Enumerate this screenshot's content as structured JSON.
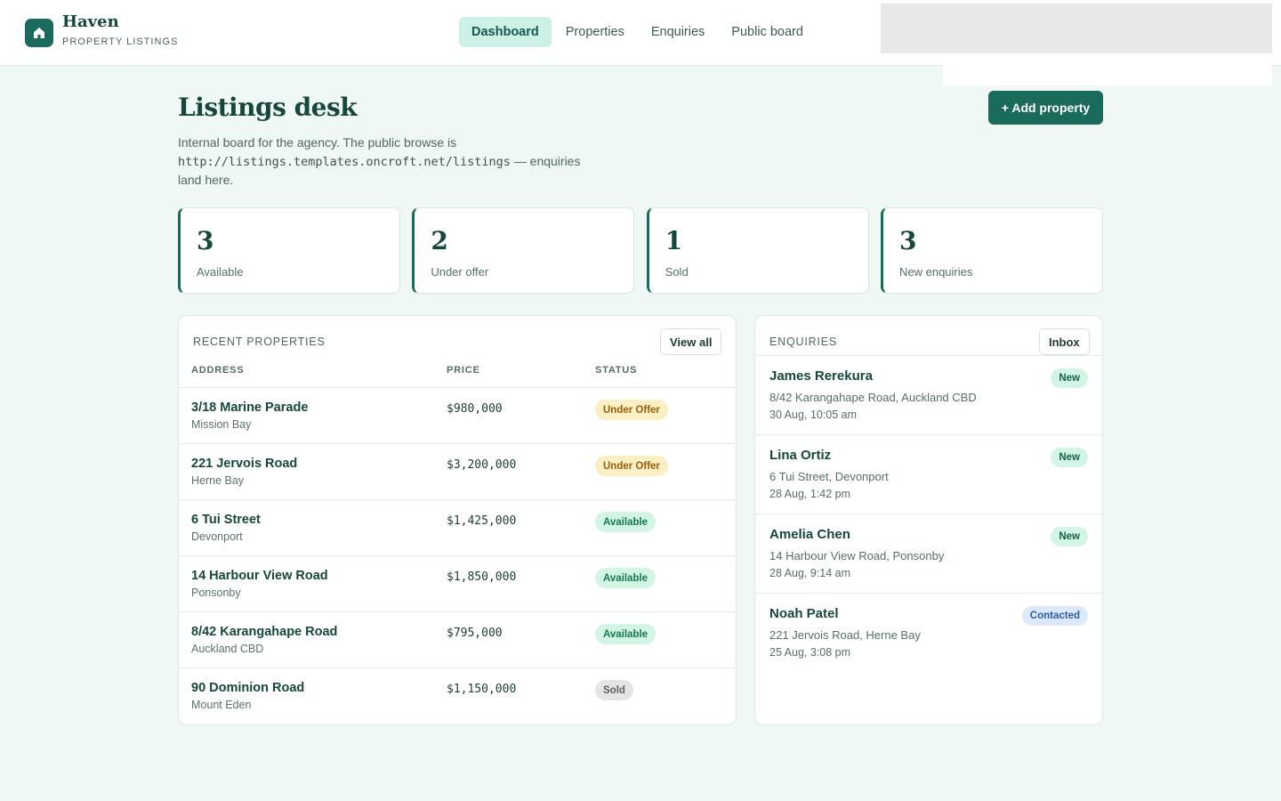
{
  "header": {
    "brand_name": "Haven",
    "brand_sub": "PROPERTY LISTINGS",
    "nav": [
      {
        "label": "Dashboard",
        "active": true
      },
      {
        "label": "Properties",
        "active": false
      },
      {
        "label": "Enquiries",
        "active": false
      },
      {
        "label": "Public board",
        "active": false
      }
    ]
  },
  "page": {
    "title": "Listings desk",
    "intro_before": "Internal board for the agency. The public browse is",
    "intro_url": "http://listings.templates.oncroft.net/listings",
    "intro_after": " — enquiries land here.",
    "add_button": "+ Add property"
  },
  "stats": [
    {
      "value": "3",
      "label": "Available"
    },
    {
      "value": "2",
      "label": "Under offer"
    },
    {
      "value": "1",
      "label": "Sold"
    },
    {
      "value": "3",
      "label": "New enquiries"
    }
  ],
  "properties": {
    "title": "RECENT PROPERTIES",
    "view_all": "View all",
    "columns": {
      "address": "ADDRESS",
      "price": "PRICE",
      "status": "STATUS"
    },
    "rows": [
      {
        "address": "3/18 Marine Parade",
        "suburb": "Mission Bay",
        "price": "$980,000",
        "status": "Under Offer",
        "kind": "offer"
      },
      {
        "address": "221 Jervois Road",
        "suburb": "Herne Bay",
        "price": "$3,200,000",
        "status": "Under Offer",
        "kind": "offer"
      },
      {
        "address": "6 Tui Street",
        "suburb": "Devonport",
        "price": "$1,425,000",
        "status": "Available",
        "kind": "avail"
      },
      {
        "address": "14 Harbour View Road",
        "suburb": "Ponsonby",
        "price": "$1,850,000",
        "status": "Available",
        "kind": "avail"
      },
      {
        "address": "8/42 Karangahape Road",
        "suburb": "Auckland CBD",
        "price": "$795,000",
        "status": "Available",
        "kind": "avail"
      },
      {
        "address": "90 Dominion Road",
        "suburb": "Mount Eden",
        "price": "$1,150,000",
        "status": "Sold",
        "kind": "sold"
      }
    ]
  },
  "enquiries": {
    "title": "ENQUIRIES",
    "inbox": "Inbox",
    "items": [
      {
        "name": "James Rerekura",
        "property": "8/42 Karangahape Road, Auckland CBD",
        "time": "30 Aug, 10:05 am",
        "status": "New",
        "kind": "new"
      },
      {
        "name": "Lina Ortiz",
        "property": "6 Tui Street, Devonport",
        "time": "28 Aug, 1:42 pm",
        "status": "New",
        "kind": "new"
      },
      {
        "name": "Amelia Chen",
        "property": "14 Harbour View Road, Ponsonby",
        "time": "28 Aug, 9:14 am",
        "status": "New",
        "kind": "new"
      },
      {
        "name": "Noah Patel",
        "property": "221 Jervois Road, Herne Bay",
        "time": "25 Aug, 3:08 pm",
        "status": "Contacted",
        "kind": "contacted"
      }
    ]
  },
  "colors": {
    "brand": "#1a6b5c",
    "background": "#f0f8f5",
    "under_offer": "#fdefc4",
    "available": "#d3f5e5",
    "sold": "#e4e6e5",
    "contacted": "#dde9fb"
  },
  "icons": {
    "brand": "home-icon"
  }
}
